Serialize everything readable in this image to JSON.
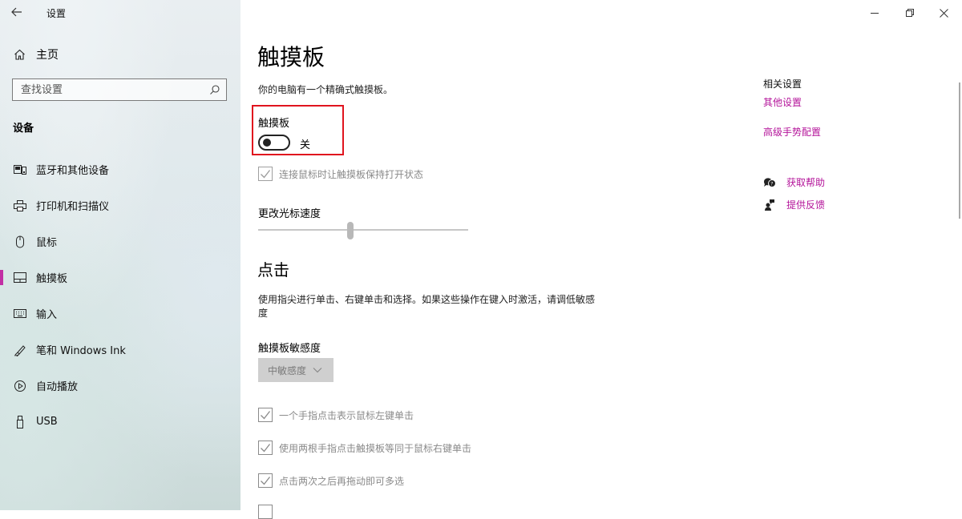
{
  "window": {
    "title": "设置",
    "back_icon": "back-arrow-icon",
    "controls": [
      "minimize-icon",
      "restore-icon",
      "close-icon"
    ]
  },
  "sidebar": {
    "home_label": "主页",
    "search_placeholder": "查找设置",
    "section_title": "设备",
    "accent": "#c22fa4",
    "items": [
      {
        "label": "蓝牙和其他设备",
        "icon": "bluetooth-devices-icon"
      },
      {
        "label": "打印机和扫描仪",
        "icon": "printer-icon"
      },
      {
        "label": "鼠标",
        "icon": "mouse-icon"
      },
      {
        "label": "触摸板",
        "icon": "touchpad-icon",
        "active": true
      },
      {
        "label": "输入",
        "icon": "keyboard-icon"
      },
      {
        "label": "笔和 Windows Ink",
        "icon": "pen-icon"
      },
      {
        "label": "自动播放",
        "icon": "autoplay-icon"
      },
      {
        "label": "USB",
        "icon": "usb-icon"
      }
    ]
  },
  "main": {
    "title": "触摸板",
    "description": "你的电脑有一个精确式触摸板。",
    "touchpad_label": "触摸板",
    "toggle_state": "关",
    "toggle_on": false,
    "keep_on_with_mouse": "连接鼠标时让触摸板保持打开状态",
    "cursor_speed_label": "更改光标速度",
    "cursor_speed_fraction": 0.44,
    "taps_title": "点击",
    "taps_description": "使用指尖进行单击、右键单击和选择。如果这些操作在键入时激活，请调低敏感度",
    "sensitivity_label": "触摸板敏感度",
    "sensitivity_value": "中敏感度",
    "checkboxes": [
      {
        "label": "一个手指点击表示鼠标左键单击",
        "checked": true
      },
      {
        "label": "使用两根手指点击触摸板等同于鼠标右键单击",
        "checked": true
      },
      {
        "label": "点击两次之后再拖动即可多选",
        "checked": true
      }
    ]
  },
  "related": {
    "title": "相关设置",
    "links": [
      "其他设置",
      "高级手势配置"
    ],
    "help": "获取帮助",
    "feedback": "提供反馈",
    "link_color": "#b4149a"
  },
  "highlight_color": "#e0141e"
}
